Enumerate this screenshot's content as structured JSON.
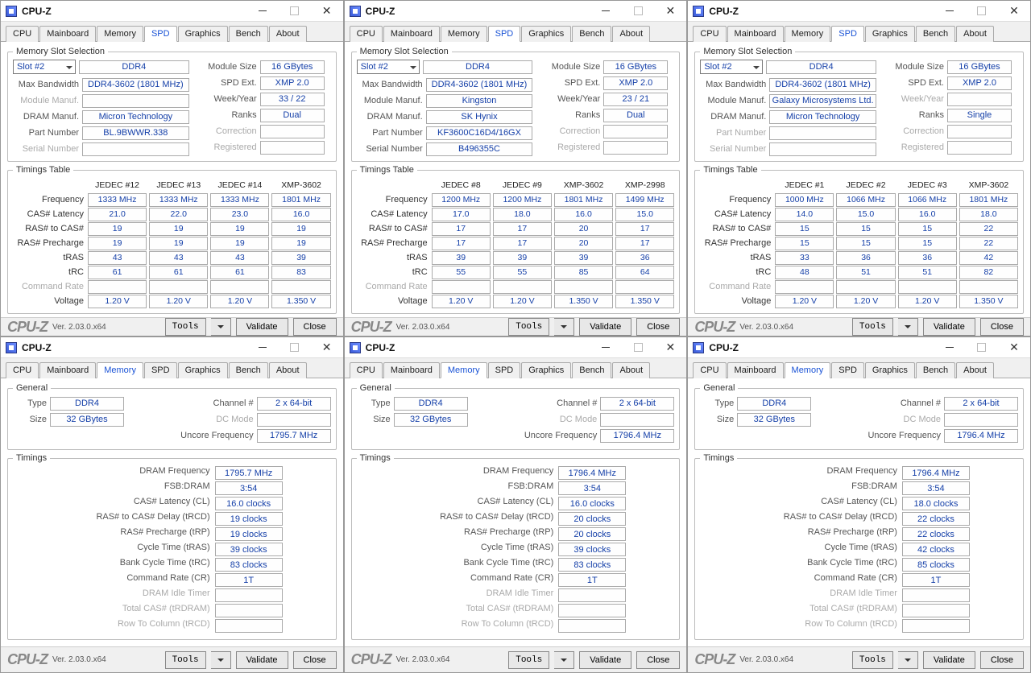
{
  "app_title": "CPU-Z",
  "footer": {
    "logo": "CPU-Z",
    "ver": "Ver. 2.03.0.x64",
    "tools": "Tools",
    "validate": "Validate",
    "close": "Close"
  },
  "tabs": [
    "CPU",
    "Mainboard",
    "Memory",
    "SPD",
    "Graphics",
    "Bench",
    "About"
  ],
  "spd_labels": {
    "group": "Memory Slot Selection",
    "slot": "Slot #2",
    "max_bw": "Max Bandwidth",
    "mod_manuf": "Module Manuf.",
    "dram_manuf": "DRAM Manuf.",
    "part": "Part Number",
    "serial": "Serial Number",
    "mod_size": "Module Size",
    "spd_ext": "SPD Ext.",
    "week": "Week/Year",
    "ranks": "Ranks",
    "corr": "Correction",
    "reg": "Registered",
    "tt_group": "Timings Table",
    "tt_rows": [
      "Frequency",
      "CAS# Latency",
      "RAS# to CAS#",
      "RAS# Precharge",
      "tRAS",
      "tRC",
      "Command Rate",
      "Voltage"
    ]
  },
  "mem_labels": {
    "gen": "General",
    "type": "Type",
    "size": "Size",
    "chan": "Channel #",
    "dc": "DC Mode",
    "uncore": "Uncore Frequency",
    "tim": "Timings",
    "rows": [
      "DRAM Frequency",
      "FSB:DRAM",
      "CAS# Latency (CL)",
      "RAS# to CAS# Delay (tRCD)",
      "RAS# Precharge (tRP)",
      "Cycle Time (tRAS)",
      "Bank Cycle Time (tRC)",
      "Command Rate (CR)",
      "DRAM Idle Timer",
      "Total CAS# (tRDRAM)",
      "Row To Column (tRCD)"
    ]
  },
  "panes": [
    {
      "active_tab": "SPD",
      "spd": {
        "type": "DDR4",
        "max_bw": "DDR4-3602 (1801 MHz)",
        "mod_manuf": "",
        "dram_manuf": "Micron Technology",
        "part": "BL.9BWWR.338",
        "serial": "",
        "mod_size": "16 GBytes",
        "spd_ext": "XMP 2.0",
        "week": "33 / 22",
        "ranks": "Dual",
        "corr": "",
        "reg": "",
        "mod_manuf_dis": true,
        "cols": [
          "JEDEC #12",
          "JEDEC #13",
          "JEDEC #14",
          "XMP-3602"
        ],
        "tt": [
          [
            "1333 MHz",
            "1333 MHz",
            "1333 MHz",
            "1801 MHz"
          ],
          [
            "21.0",
            "22.0",
            "23.0",
            "16.0"
          ],
          [
            "19",
            "19",
            "19",
            "19"
          ],
          [
            "19",
            "19",
            "19",
            "19"
          ],
          [
            "43",
            "43",
            "43",
            "39"
          ],
          [
            "61",
            "61",
            "61",
            "83"
          ],
          [
            "",
            "",
            "",
            ""
          ],
          [
            "1.20 V",
            "1.20 V",
            "1.20 V",
            "1.350 V"
          ]
        ]
      }
    },
    {
      "active_tab": "SPD",
      "spd": {
        "type": "DDR4",
        "max_bw": "DDR4-3602 (1801 MHz)",
        "mod_manuf": "Kingston",
        "dram_manuf": "SK Hynix",
        "part": "KF3600C16D4/16GX",
        "serial": "B496355C",
        "mod_size": "16 GBytes",
        "spd_ext": "XMP 2.0",
        "week": "23 / 21",
        "ranks": "Dual",
        "corr": "",
        "reg": "",
        "mod_manuf_dis": false,
        "cols": [
          "JEDEC #8",
          "JEDEC #9",
          "XMP-3602",
          "XMP-2998"
        ],
        "tt": [
          [
            "1200 MHz",
            "1200 MHz",
            "1801 MHz",
            "1499 MHz"
          ],
          [
            "17.0",
            "18.0",
            "16.0",
            "15.0"
          ],
          [
            "17",
            "17",
            "20",
            "17"
          ],
          [
            "17",
            "17",
            "20",
            "17"
          ],
          [
            "39",
            "39",
            "39",
            "36"
          ],
          [
            "55",
            "55",
            "85",
            "64"
          ],
          [
            "",
            "",
            "",
            ""
          ],
          [
            "1.20 V",
            "1.20 V",
            "1.350 V",
            "1.350 V"
          ]
        ]
      }
    },
    {
      "active_tab": "SPD",
      "spd": {
        "type": "DDR4",
        "max_bw": "DDR4-3602 (1801 MHz)",
        "mod_manuf": "Galaxy Microsystems Ltd.",
        "dram_manuf": "Micron Technology",
        "part": "",
        "serial": "",
        "mod_size": "16 GBytes",
        "spd_ext": "XMP 2.0",
        "week": "",
        "ranks": "Single",
        "corr": "",
        "reg": "",
        "mod_manuf_dis": false,
        "week_dis": true,
        "cols": [
          "JEDEC #1",
          "JEDEC #2",
          "JEDEC #3",
          "XMP-3602"
        ],
        "tt": [
          [
            "1000 MHz",
            "1066 MHz",
            "1066 MHz",
            "1801 MHz"
          ],
          [
            "14.0",
            "15.0",
            "16.0",
            "18.0"
          ],
          [
            "15",
            "15",
            "15",
            "22"
          ],
          [
            "15",
            "15",
            "15",
            "22"
          ],
          [
            "33",
            "36",
            "36",
            "42"
          ],
          [
            "48",
            "51",
            "51",
            "82"
          ],
          [
            "",
            "",
            "",
            ""
          ],
          [
            "1.20 V",
            "1.20 V",
            "1.20 V",
            "1.350 V"
          ]
        ]
      }
    },
    {
      "active_tab": "Memory",
      "mem": {
        "type": "DDR4",
        "size": "32 GBytes",
        "chan": "2 x 64-bit",
        "dc": "",
        "uncore": "1795.7 MHz",
        "vals": [
          "1795.7 MHz",
          "3:54",
          "16.0 clocks",
          "19 clocks",
          "19 clocks",
          "39 clocks",
          "83 clocks",
          "1T",
          "",
          "",
          ""
        ]
      }
    },
    {
      "active_tab": "Memory",
      "mem": {
        "type": "DDR4",
        "size": "32 GBytes",
        "chan": "2 x 64-bit",
        "dc": "",
        "uncore": "1796.4 MHz",
        "vals": [
          "1796.4 MHz",
          "3:54",
          "16.0 clocks",
          "20 clocks",
          "20 clocks",
          "39 clocks",
          "83 clocks",
          "1T",
          "",
          "",
          ""
        ]
      }
    },
    {
      "active_tab": "Memory",
      "mem": {
        "type": "DDR4",
        "size": "32 GBytes",
        "chan": "2 x 64-bit",
        "dc": "",
        "uncore": "1796.4 MHz",
        "vals": [
          "1796.4 MHz",
          "3:54",
          "18.0 clocks",
          "22 clocks",
          "22 clocks",
          "42 clocks",
          "85 clocks",
          "1T",
          "",
          "",
          ""
        ]
      }
    }
  ]
}
